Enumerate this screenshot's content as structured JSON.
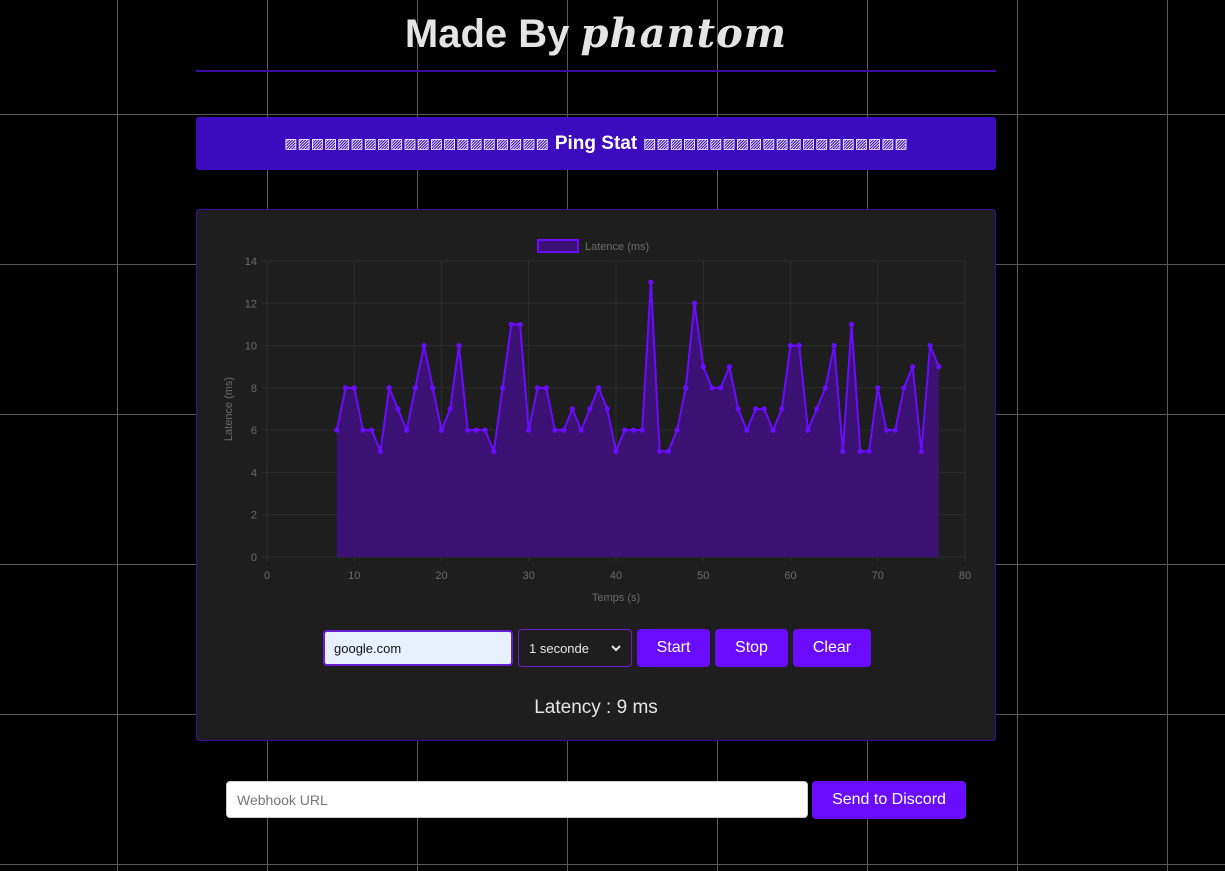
{
  "header": {
    "title_prefix": "Made By",
    "author": "phantom"
  },
  "banner": {
    "left_blocks": "▨▨▨▨▨▨▨▨▨▨▨▨▨▨▨▨▨▨▨▨",
    "title": "Ping Stat",
    "right_blocks": "▨▨▨▨▨▨▨▨▨▨▨▨▨▨▨▨▨▨▨▨"
  },
  "controls": {
    "host_value": "google.com",
    "interval_value": "1 seconde",
    "start_label": "Start",
    "stop_label": "Stop",
    "clear_label": "Clear"
  },
  "status": {
    "latency_text": "Latency : 9 ms"
  },
  "webhook": {
    "placeholder": "Webhook URL",
    "send_label": "Send to Discord"
  },
  "colors": {
    "accent": "#6a0dff",
    "banner": "#3d0bbf",
    "line": "#6a0dff",
    "fill": "#3b1273"
  },
  "chart_data": {
    "type": "area",
    "legend": [
      "Latence (ms)"
    ],
    "xlabel": "Temps (s)",
    "ylabel": "Latence (ms)",
    "xlim": [
      0,
      80
    ],
    "ylim": [
      0,
      14
    ],
    "xticks": [
      0,
      10,
      20,
      30,
      40,
      50,
      60,
      70,
      80
    ],
    "yticks": [
      0,
      2,
      4,
      6,
      8,
      10,
      12,
      14
    ],
    "grid": true,
    "legend_position": "top",
    "x": [
      8,
      9,
      10,
      11,
      12,
      13,
      14,
      15,
      16,
      17,
      18,
      19,
      20,
      21,
      22,
      23,
      24,
      25,
      26,
      27,
      28,
      29,
      30,
      31,
      32,
      33,
      34,
      35,
      36,
      37,
      38,
      39,
      40,
      41,
      42,
      43,
      44,
      45,
      46,
      47,
      48,
      49,
      50,
      51,
      52,
      53,
      54,
      55,
      56,
      57,
      58,
      59,
      60,
      61,
      62,
      63,
      64,
      65,
      66,
      67,
      68,
      69,
      70,
      71,
      72,
      73,
      74,
      75,
      76,
      77
    ],
    "series": [
      {
        "name": "Latence (ms)",
        "values": [
          6,
          8,
          8,
          6,
          6,
          5,
          8,
          7,
          6,
          8,
          10,
          8,
          6,
          7,
          10,
          6,
          6,
          6,
          5,
          8,
          11,
          11,
          6,
          8,
          8,
          6,
          6,
          7,
          6,
          7,
          8,
          7,
          5,
          6,
          6,
          6,
          13,
          5,
          5,
          6,
          8,
          12,
          9,
          8,
          8,
          9,
          7,
          6,
          7,
          7,
          6,
          7,
          10,
          10,
          6,
          7,
          8,
          10,
          5,
          11,
          5,
          5,
          8,
          6,
          6,
          8,
          9,
          5,
          10,
          9
        ]
      }
    ]
  }
}
